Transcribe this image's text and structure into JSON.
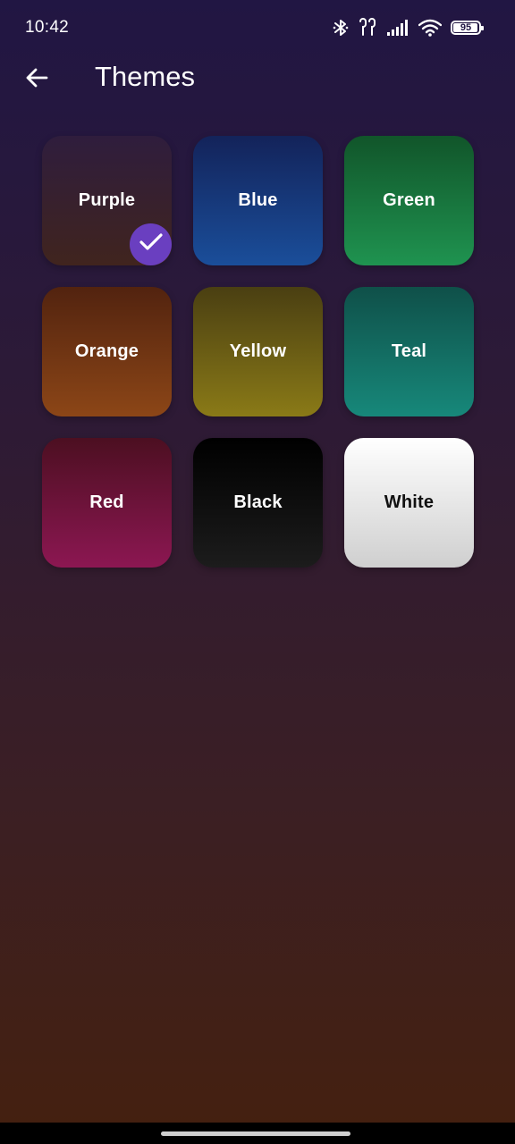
{
  "status_bar": {
    "time": "10:42",
    "battery_level": "95",
    "icons": [
      "bluetooth-icon",
      "earbuds-icon",
      "signal-icon",
      "wifi-icon",
      "battery-icon"
    ]
  },
  "app_bar": {
    "title": "Themes",
    "back_icon": "arrow-left-icon"
  },
  "themes": [
    {
      "label": "Purple",
      "selected": true,
      "colors": [
        "#2f1d3d",
        "#40241e"
      ]
    },
    {
      "label": "Blue",
      "selected": false,
      "colors": [
        "#13235a",
        "#1a4e9a"
      ]
    },
    {
      "label": "Green",
      "selected": false,
      "colors": [
        "#11552a",
        "#1f9350"
      ]
    },
    {
      "label": "Orange",
      "selected": false,
      "colors": [
        "#52230f",
        "#8c4617"
      ]
    },
    {
      "label": "Yellow",
      "selected": false,
      "colors": [
        "#4a3f12",
        "#8a7a17"
      ]
    },
    {
      "label": "Teal",
      "selected": false,
      "colors": [
        "#0f5049",
        "#17887a"
      ]
    },
    {
      "label": "Red",
      "selected": false,
      "colors": [
        "#4c0f21",
        "#8c1752"
      ]
    },
    {
      "label": "Black",
      "selected": false,
      "colors": [
        "#000000",
        "#1c1c1c"
      ]
    },
    {
      "label": "White",
      "selected": false,
      "colors": [
        "#ffffff",
        "#cfcfcf"
      ]
    }
  ],
  "accent_color": "#6a3fc0"
}
